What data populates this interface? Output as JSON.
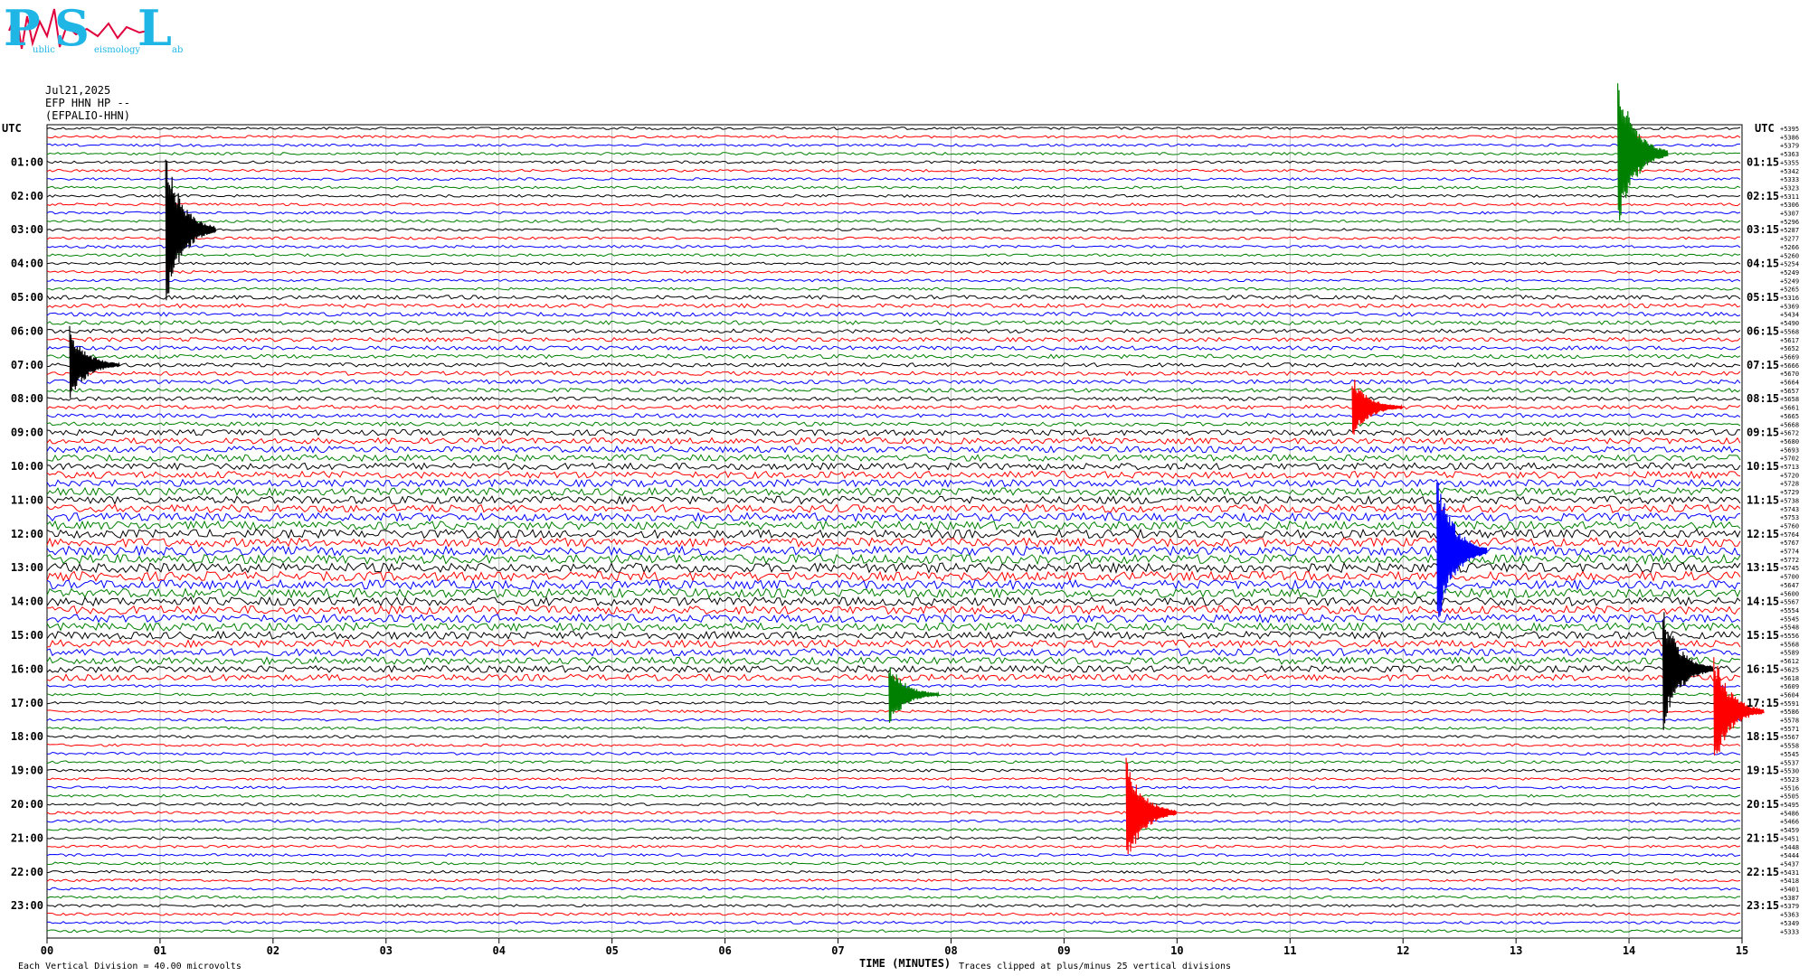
{
  "logo": {
    "letters": [
      "P",
      "S",
      "L"
    ],
    "small_words": [
      "ublic",
      "eismology",
      "ab"
    ]
  },
  "header": {
    "date": "Jul21,2025",
    "station": "EFP HHN HP --",
    "station_name": "(EFPALIO-HHN)",
    "utc_left": "UTC",
    "utc_right": "UTC"
  },
  "footer": {
    "vertical_division": "Each Vertical Division =  40.00 microvolts",
    "clip_note": "Traces clipped at plus/minus 25 vertical divisions",
    "x_axis_title": "TIME (MINUTES)"
  },
  "chart_data": {
    "type": "line",
    "title": "",
    "xlabel": "TIME (MINUTES)",
    "ylabel": "UTC",
    "xlim": [
      0,
      15
    ],
    "x_ticks": [
      "00",
      "01",
      "02",
      "03",
      "04",
      "05",
      "06",
      "07",
      "08",
      "09",
      "10",
      "11",
      "12",
      "13",
      "14",
      "15"
    ],
    "left_hour_labels": [
      "01:00",
      "02:00",
      "03:00",
      "04:00",
      "05:00",
      "06:00",
      "07:00",
      "08:00",
      "09:00",
      "10:00",
      "11:00",
      "12:00",
      "13:00",
      "14:00",
      "15:00",
      "16:00",
      "17:00",
      "18:00",
      "19:00",
      "20:00",
      "21:00",
      "22:00",
      "23:00"
    ],
    "right_hour_labels": [
      "01:15",
      "02:15",
      "03:15",
      "04:15",
      "05:15",
      "06:15",
      "07:15",
      "08:15",
      "09:15",
      "10:15",
      "11:15",
      "12:15",
      "13:15",
      "14:15",
      "15:15",
      "16:15",
      "17:15",
      "18:15",
      "19:15",
      "20:15",
      "21:15",
      "22:15",
      "23:15"
    ],
    "trace_colors": [
      "#000000",
      "#ff0000",
      "#0000ff",
      "#008000"
    ],
    "trace_count": 96,
    "minutes_per_trace": 15,
    "right_offsets": [
      "+5395",
      "+5386",
      "+5379",
      "+5363",
      "+5355",
      "+5342",
      "+5333",
      "+5323",
      "+5311",
      "+5306",
      "+5307",
      "+5296",
      "+5287",
      "+5277",
      "+5266",
      "+5260",
      "+5254",
      "+5249",
      "+5249",
      "+5265",
      "+5316",
      "+5369",
      "+5434",
      "+5490",
      "+5568",
      "+5617",
      "+5652",
      "+5669",
      "+5666",
      "+5670",
      "+5664",
      "+5657",
      "+5658",
      "+5661",
      "+5665",
      "+5668",
      "+5672",
      "+5680",
      "+5693",
      "+5702",
      "+5713",
      "+5720",
      "+5728",
      "+5729",
      "+5738",
      "+5743",
      "+5753",
      "+5760",
      "+5764",
      "+5767",
      "+5774",
      "+5772",
      "+5745",
      "+5700",
      "+5647",
      "+5600",
      "+5567",
      "+5554",
      "+5545",
      "+5548",
      "+5556",
      "+5568",
      "+5589",
      "+5612",
      "+5625",
      "+5618",
      "+5609",
      "+5604",
      "+5591",
      "+5586",
      "+5578",
      "+5571",
      "+5567",
      "+5558",
      "+5545",
      "+5537",
      "+5530",
      "+5523",
      "+5516",
      "+5505",
      "+5495",
      "+5486",
      "+5466",
      "+5459",
      "+5451",
      "+5448",
      "+5444",
      "+5437",
      "+5431",
      "+5418",
      "+5401",
      "+5387",
      "+5379",
      "+5363",
      "+5349",
      "+5333"
    ],
    "events": [
      {
        "trace": 3,
        "minute": 13.9,
        "amplitude": 25,
        "label": "clipped"
      },
      {
        "trace": 12,
        "minute": 1.05,
        "amplitude": 25,
        "label": "clipped"
      },
      {
        "trace": 28,
        "minute": 0.2,
        "amplitude": 12
      },
      {
        "trace": 33,
        "minute": 11.55,
        "amplitude": 10
      },
      {
        "trace": 50,
        "minute": 12.3,
        "amplitude": 25,
        "label": "clipped"
      },
      {
        "trace": 64,
        "minute": 14.3,
        "amplitude": 20
      },
      {
        "trace": 67,
        "minute": 7.45,
        "amplitude": 10
      },
      {
        "trace": 69,
        "minute": 14.75,
        "amplitude": 18
      },
      {
        "trace": 81,
        "minute": 9.55,
        "amplitude": 18
      }
    ]
  }
}
